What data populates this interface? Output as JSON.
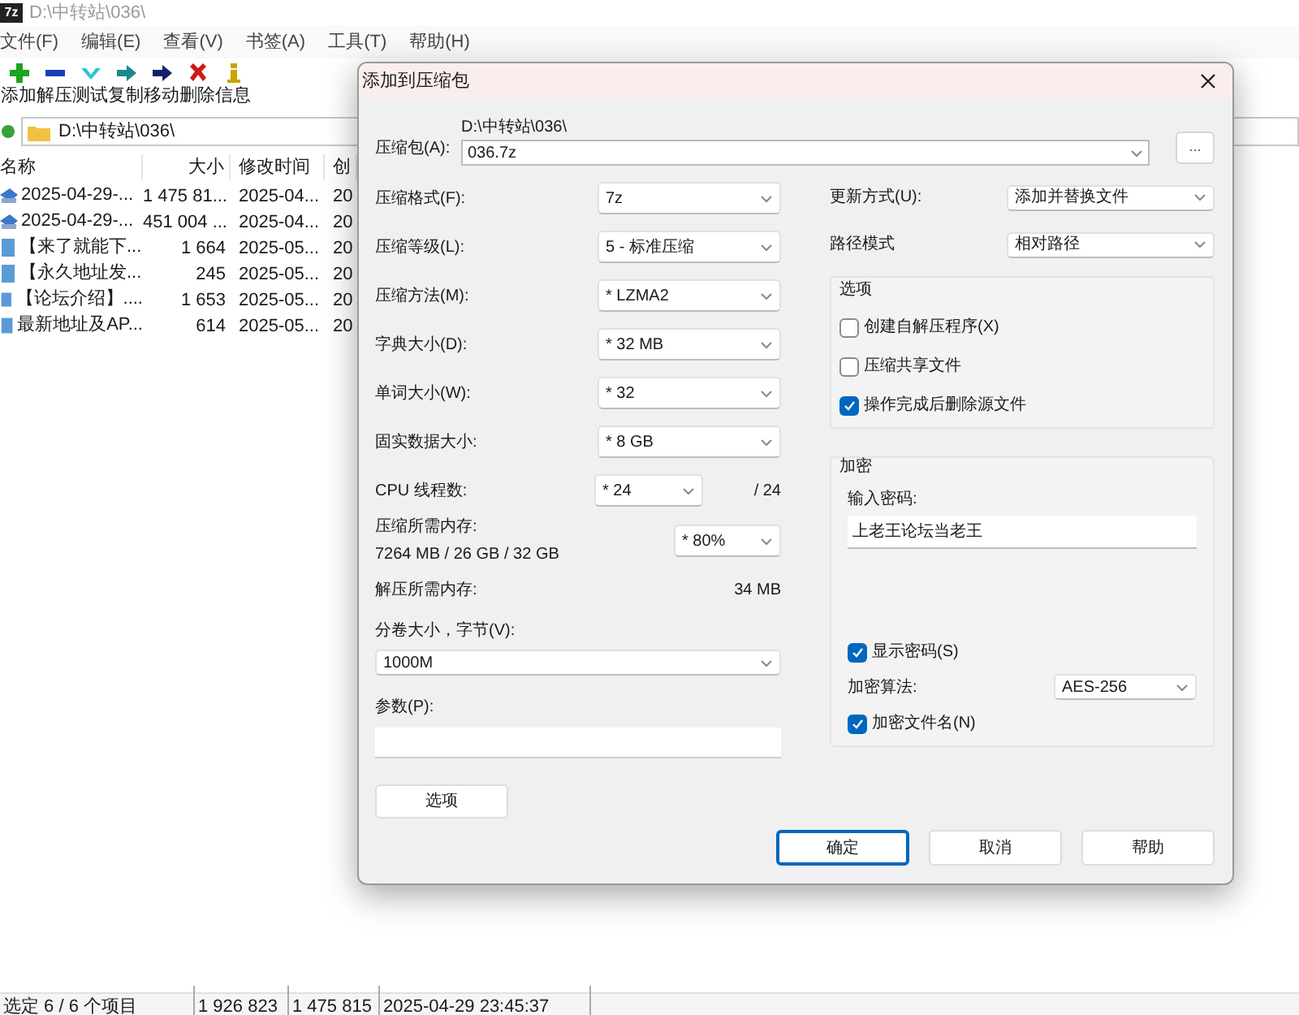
{
  "main_window": {
    "logo": "7z",
    "title": "D:\\中转站\\036\\"
  },
  "menu": [
    "文件(F)",
    "编辑(E)",
    "查看(V)",
    "书签(A)",
    "工具(T)",
    "帮助(H)"
  ],
  "toolbar": [
    {
      "kind": "add",
      "label": "添加"
    },
    {
      "kind": "extract",
      "label": "解压"
    },
    {
      "kind": "test",
      "label": "测试"
    },
    {
      "kind": "copy",
      "label": "复制"
    },
    {
      "kind": "move",
      "label": "移动"
    },
    {
      "kind": "delete",
      "label": "删除"
    },
    {
      "kind": "info",
      "label": "信息"
    }
  ],
  "address": "D:\\中转站\\036\\",
  "columns": [
    "名称",
    "大小",
    "修改时间",
    "创"
  ],
  "rows": [
    {
      "kind": "archive",
      "cells": [
        "2025-04-29-...",
        "1 475 81...",
        "2025-04...",
        "20"
      ]
    },
    {
      "kind": "archive",
      "cells": [
        "2025-04-29-...",
        "451 004 ...",
        "2025-04...",
        "20"
      ]
    },
    {
      "kind": "file",
      "cells": [
        "【来了就能下...",
        "1 664",
        "2025-05...",
        "20"
      ]
    },
    {
      "kind": "file",
      "cells": [
        "【永久地址发...",
        "245",
        "2025-05...",
        "20"
      ]
    },
    {
      "kind": "file",
      "cells": [
        "【论坛介绍】....",
        "1 653",
        "2025-05...",
        "20"
      ]
    },
    {
      "kind": "file",
      "cells": [
        "最新地址及AP...",
        "614",
        "2025-05...",
        "20"
      ]
    }
  ],
  "status_bar": [
    "选定 6 / 6 个项目",
    "1 926 823",
    "1 475 815",
    "2025-04-29 23:45:37"
  ],
  "dialog": {
    "title": "添加到压缩包",
    "archive": {
      "label": "压缩包(A):",
      "path": "D:\\中转站\\036\\",
      "value": "036.7z",
      "browse": "..."
    },
    "left": [
      {
        "kind": "select",
        "label": "压缩格式(F):",
        "value": "7z"
      },
      {
        "kind": "select",
        "label": "压缩等级(L):",
        "value": "5 - 标准压缩"
      },
      {
        "kind": "select",
        "label": "压缩方法(M):",
        "value": "* LZMA2"
      },
      {
        "kind": "select",
        "label": "字典大小(D):",
        "value": "* 32 MB"
      },
      {
        "kind": "select",
        "label": "单词大小(W):",
        "value": "* 32"
      },
      {
        "kind": "select",
        "label": "固实数据大小:",
        "value": "* 8 GB"
      },
      {
        "kind": "cpu",
        "label": "CPU 线程数:",
        "value": "* 24",
        "suffix": "/ 24"
      },
      {
        "kind": "memory",
        "label": "压缩所需内存:",
        "detail": "7264 MB / 26 GB / 32 GB",
        "value": "* 80%"
      },
      {
        "kind": "info",
        "label": "解压所需内存:",
        "value": "34 MB"
      },
      {
        "kind": "stacked-select",
        "label": "分卷大小，字节(V):",
        "value": "1000M"
      },
      {
        "kind": "stacked-input",
        "label": "参数(P):"
      }
    ],
    "options_button": "选项",
    "update": {
      "label": "更新方式(U):",
      "value": "添加并替换文件"
    },
    "path_mode": {
      "label": "路径模式",
      "value": "相对路径"
    },
    "options": {
      "title": "选项",
      "items": [
        {
          "label": "创建自解压程序(X)",
          "checked": false
        },
        {
          "label": "压缩共享文件",
          "checked": false
        },
        {
          "label": "操作完成后删除源文件",
          "checked": true
        }
      ]
    },
    "encryption": {
      "title": "加密",
      "password_label": "输入密码:",
      "password": "上老王论坛当老王",
      "show_password": {
        "label": "显示密码(S)",
        "checked": true
      },
      "method": {
        "label": "加密算法:",
        "value": "AES-256"
      },
      "encrypt_names": {
        "label": "加密文件名(N)",
        "checked": true
      }
    },
    "buttons": [
      {
        "label": "确定",
        "focused": true
      },
      {
        "label": "取消",
        "focused": false
      },
      {
        "label": "帮助",
        "focused": false
      }
    ]
  }
}
